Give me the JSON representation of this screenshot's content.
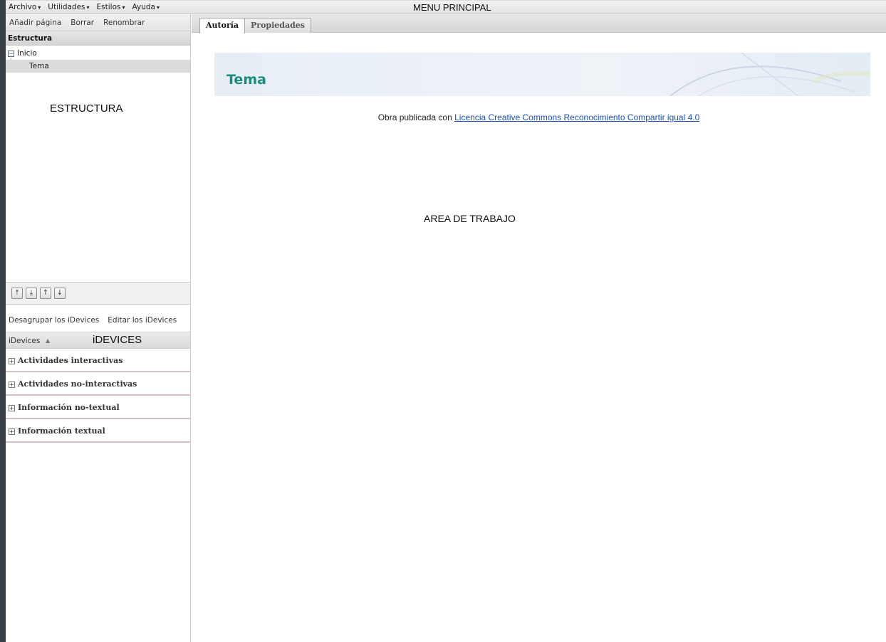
{
  "menubar": {
    "menus": [
      {
        "label": "Archivo"
      },
      {
        "label": "Utilidades"
      },
      {
        "label": "Estilos"
      },
      {
        "label": "Ayuda"
      }
    ],
    "annotation": "MENU PRINCIPAL"
  },
  "pagebar": {
    "add": "Añadir página",
    "delete": "Borrar",
    "rename": "Renombrar"
  },
  "structure": {
    "heading": "Estructura",
    "root": "Inicio",
    "child": "Tema",
    "annotation": "ESTRUCTURA"
  },
  "move_buttons": [
    "move-top",
    "move-down-level",
    "move-up",
    "move-down"
  ],
  "idevices": {
    "ungroup": "Desagrupar los iDevices",
    "edit": "Editar los iDevices",
    "heading": "iDevices",
    "annotation": "iDEVICES",
    "categories": [
      "Actividades interactivas",
      "Actividades no-interactivas",
      "Información no-textual",
      "Información textual"
    ]
  },
  "tabs": {
    "authoring": "Autoría",
    "properties": "Propiedades"
  },
  "content": {
    "title": "Tema",
    "license_prefix": "Obra publicada con",
    "license_link": "Licencia Creative Commons Reconocimiento Compartir igual 4.0",
    "annotation": "AREA DE TRABAJO"
  },
  "colors": {
    "title": "#1a8c7c",
    "link": "#1b4fb5",
    "category_border": "#d9bfc7"
  }
}
